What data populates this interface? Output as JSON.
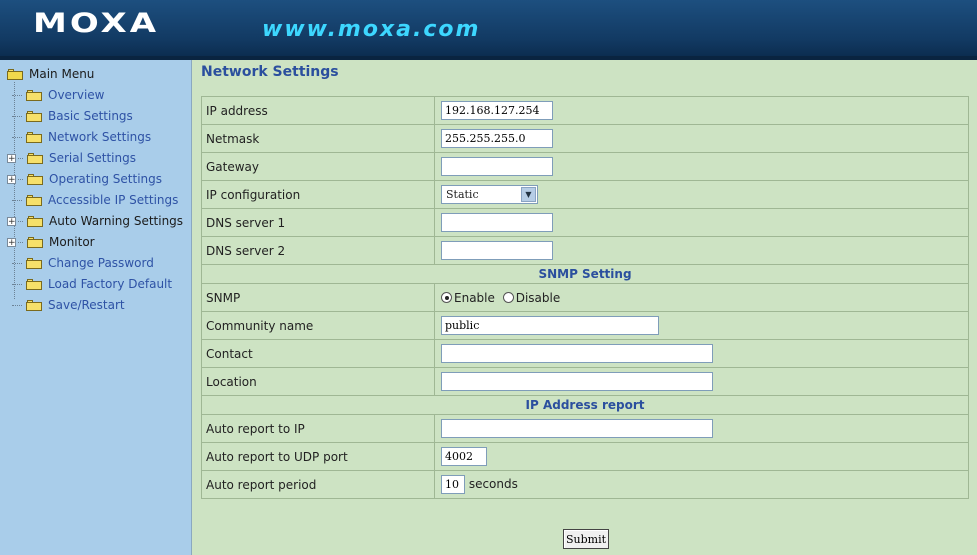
{
  "header": {
    "logo": "MOXA",
    "url": "www.moxa.com"
  },
  "sidebar": {
    "root_label": "Main Menu",
    "items": [
      {
        "label": "Overview",
        "expandable": false
      },
      {
        "label": "Basic Settings",
        "expandable": false
      },
      {
        "label": "Network Settings",
        "expandable": false
      },
      {
        "label": "Serial Settings",
        "expandable": true
      },
      {
        "label": "Operating Settings",
        "expandable": true
      },
      {
        "label": "Accessible IP Settings",
        "expandable": false
      },
      {
        "label": "Auto Warning Settings",
        "expandable": true
      },
      {
        "label": "Monitor",
        "expandable": true
      },
      {
        "label": "Change Password",
        "expandable": false
      },
      {
        "label": "Load Factory Default",
        "expandable": false
      },
      {
        "label": "Save/Restart",
        "expandable": false
      }
    ]
  },
  "page": {
    "title": "Network Settings"
  },
  "network": {
    "ip_label": "IP address",
    "ip_value": "192.168.127.254",
    "netmask_label": "Netmask",
    "netmask_value": "255.255.255.0",
    "gateway_label": "Gateway",
    "gateway_value": "",
    "ipconfig_label": "IP configuration",
    "ipconfig_value": "Static",
    "dns1_label": "DNS server 1",
    "dns1_value": "",
    "dns2_label": "DNS server 2",
    "dns2_value": ""
  },
  "snmp": {
    "section_title": "SNMP Setting",
    "snmp_label": "SNMP",
    "enable_label": "Enable",
    "disable_label": "Disable",
    "selected": "Enable",
    "community_label": "Community name",
    "community_value": "public",
    "contact_label": "Contact",
    "contact_value": "",
    "location_label": "Location",
    "location_value": ""
  },
  "ip_report": {
    "section_title": "IP Address report",
    "auto_ip_label": "Auto report to IP",
    "auto_ip_value": "",
    "udp_port_label": "Auto report to UDP port",
    "udp_port_value": "4002",
    "period_label": "Auto report period",
    "period_value": "10",
    "period_unit": "seconds"
  },
  "buttons": {
    "submit": "Submit"
  },
  "colors": {
    "header_bg": "#123a63",
    "url_text": "#3dd7ff",
    "sidebar_bg": "#a9cdea",
    "main_bg": "#cde3c3",
    "title_text": "#2b4f9e",
    "link_text": "#2e52a5"
  }
}
